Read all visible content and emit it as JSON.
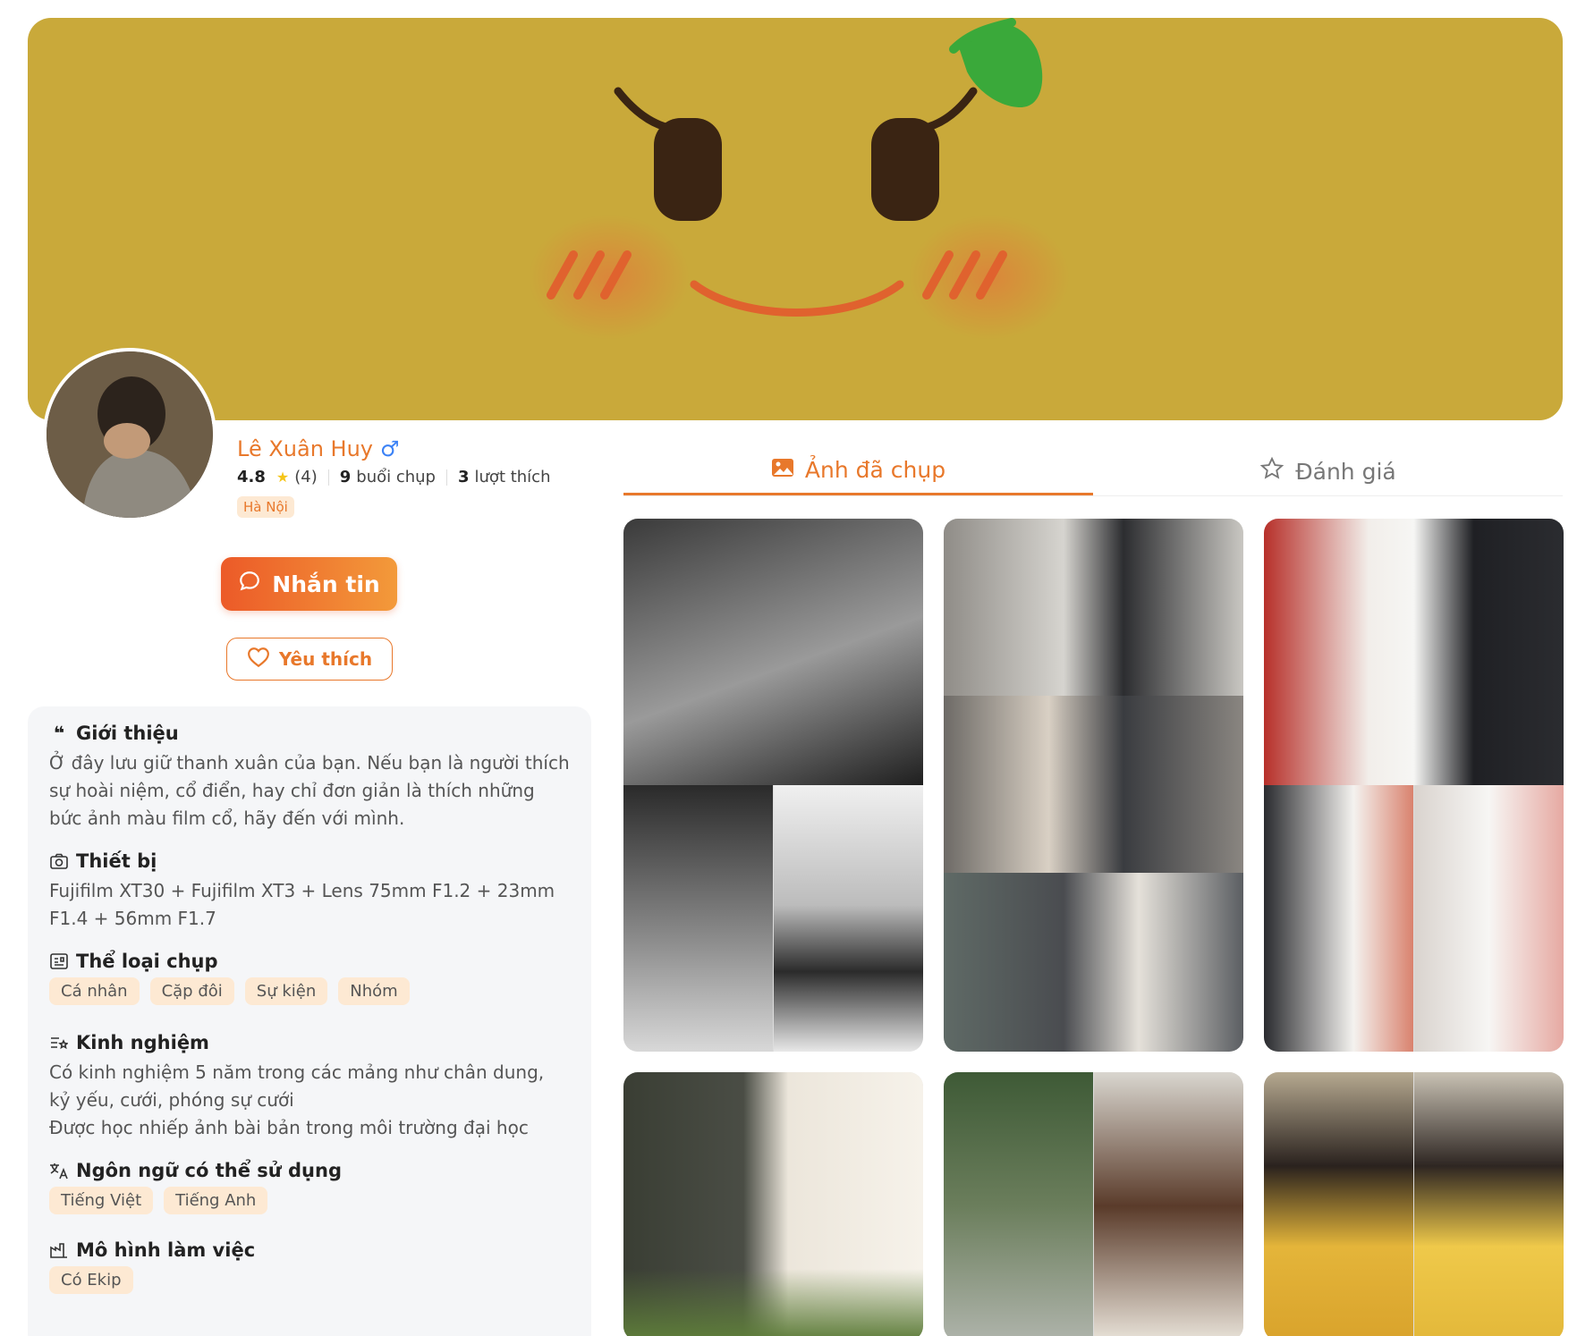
{
  "cover": {
    "image": "orange-face-cover"
  },
  "profile": {
    "name": "Lê Xuân Huy",
    "gender_icon": "male-icon",
    "rating": "4.8",
    "rating_count": "(4)",
    "sessions_count": "9",
    "sessions_label": "buổi chụp",
    "likes_count": "3",
    "likes_label": "lượt thích",
    "region": "Hà Nội"
  },
  "actions": {
    "message_label": "Nhắn tin",
    "favorite_label": "Yêu thích"
  },
  "info": {
    "intro_title": "Giới thiệu",
    "intro_text": "Ở đây lưu giữ thanh xuân của bạn. Nếu bạn là người thích sự hoài niệm, cổ điển, hay chỉ đơn giản là thích những bức ảnh màu film cổ, hãy đến với mình.",
    "equipment_title": "Thiết bị",
    "equipment_text": "Fujifilm XT30 + Fujifilm XT3 + Lens 75mm F1.2 + 23mm F1.4 + 56mm F1.7",
    "genre_title": "Thể loại chụp",
    "genres": [
      "Cá nhân",
      "Cặp đôi",
      "Sự kiện",
      "Nhóm"
    ],
    "experience_title": "Kinh nghiệm",
    "experience_text": "Có kinh nghiệm 5 năm trong các mảng như chân dung, kỷ yếu, cưới, phóng sự cưới\nĐược học nhiếp ảnh bài bản trong môi trường đại học",
    "language_title": "Ngôn ngữ có thể sử dụng",
    "languages": [
      "Tiếng Việt",
      "Tiếng Anh"
    ],
    "workmodel_title": "Mô hình làm việc",
    "workmodels": [
      "Có Ekip"
    ]
  },
  "tabs": [
    {
      "label": "Ảnh đã chụp",
      "icon": "image-icon"
    },
    {
      "label": "Đánh giá",
      "icon": "star-outline-icon"
    }
  ],
  "colors": {
    "accent": "#e8782b",
    "cover": "#c9a93a"
  }
}
